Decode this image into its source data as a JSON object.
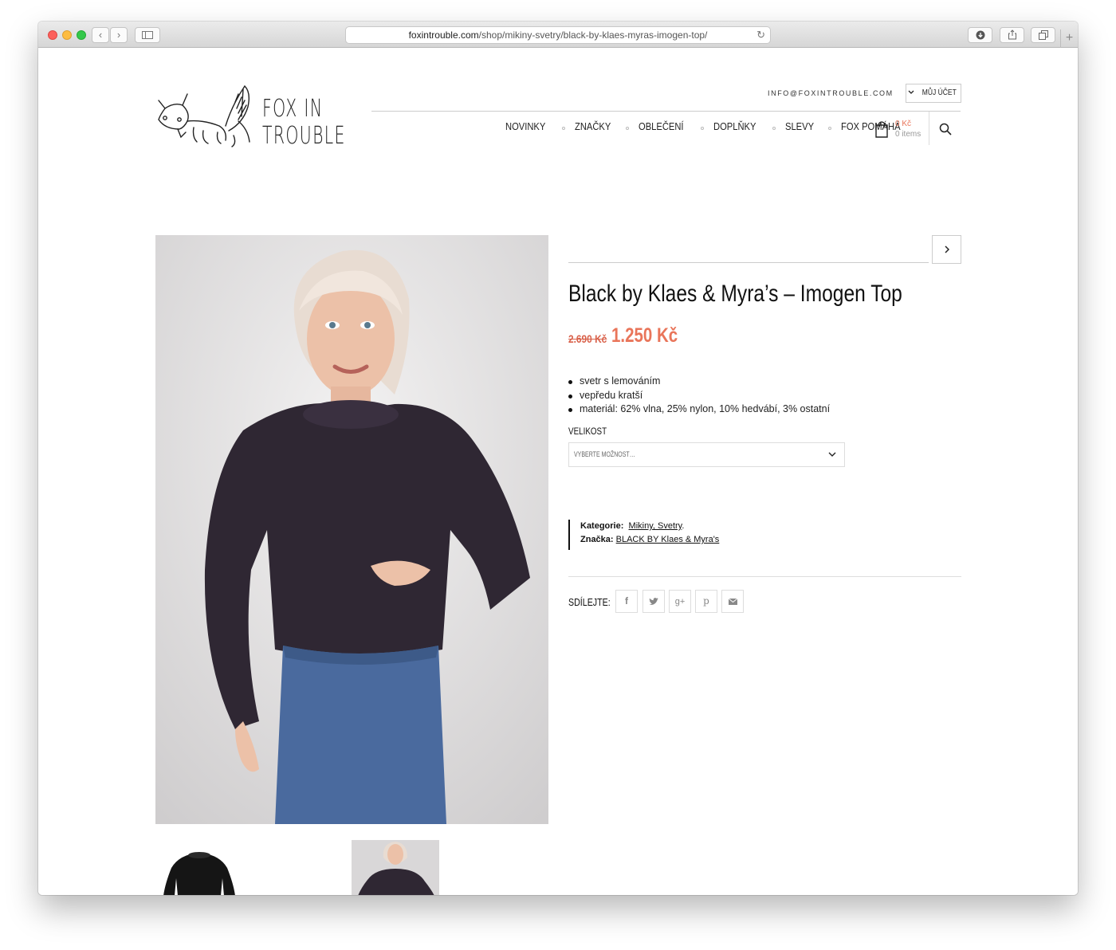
{
  "browser": {
    "url_host": "foxintrouble.com",
    "url_path": "/shop/mikiny-svetry/black-by-klaes-myras-imogen-top/",
    "reload_icon": "reload-icon"
  },
  "header": {
    "logo_line1": "FOX  IN",
    "logo_line2": "TROUBLE",
    "email": "INFO@FOXINTROUBLE.COM",
    "account_label": "MŮJ ÚČET",
    "nav": [
      "NOVINKY",
      "ZNAČKY",
      "OBLEČENÍ",
      "DOPLŇKY",
      "SLEVY",
      "FOX POMÁHÁ"
    ],
    "cart_price": "0 Kč",
    "cart_items": "0 items"
  },
  "product": {
    "title": "Black by Klaes & Myra’s – Imogen Top",
    "price_old": "2.690 Kč",
    "price_new": "1.250 Kč",
    "features": [
      "svetr s lemováním",
      "vepředu kratší",
      "materiál: 62% vlna, 25% nylon, 10% hedvábí, 3% ostatní"
    ],
    "size_label": "VELIKOST",
    "size_placeholder": "VYBERTE MOŽNOST…",
    "category_label": "Kategorie:",
    "category_value": "Mikiny, Svetry",
    "category_suffix": ".",
    "brand_label": "Značka:",
    "brand_value": "BLACK BY Klaes & Myra's",
    "share_label": "SDÍLEJTE:",
    "share_icons": [
      "facebook-icon",
      "twitter-icon",
      "google-plus-icon",
      "pinterest-icon",
      "email-icon"
    ]
  },
  "colors": {
    "accent": "#e9755a",
    "sweater": "#2f2733",
    "jeans": "#4a6a9e"
  }
}
